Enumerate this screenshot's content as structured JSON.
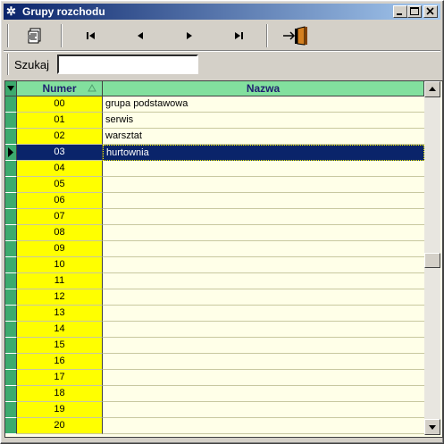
{
  "window": {
    "title": "Grupy rozchodu",
    "controls": [
      "minimize-icon",
      "maximize-icon",
      "close-icon"
    ]
  },
  "toolbar": {
    "buttons": [
      "report-icon",
      "first-record-icon",
      "prior-record-icon",
      "next-record-icon",
      "last-record-icon",
      "exit-icon"
    ]
  },
  "search": {
    "label": "Szukaj",
    "value": ""
  },
  "table": {
    "columns": [
      "Numer",
      "Nazwa"
    ],
    "selected_index": 3,
    "rows": [
      {
        "numer": "00",
        "nazwa": "grupa podstawowa"
      },
      {
        "numer": "01",
        "nazwa": "serwis"
      },
      {
        "numer": "02",
        "nazwa": "warsztat"
      },
      {
        "numer": "03",
        "nazwa": "hurtownia"
      },
      {
        "numer": "04",
        "nazwa": ""
      },
      {
        "numer": "05",
        "nazwa": ""
      },
      {
        "numer": "06",
        "nazwa": ""
      },
      {
        "numer": "07",
        "nazwa": ""
      },
      {
        "numer": "08",
        "nazwa": ""
      },
      {
        "numer": "09",
        "nazwa": ""
      },
      {
        "numer": "10",
        "nazwa": ""
      },
      {
        "numer": "11",
        "nazwa": ""
      },
      {
        "numer": "12",
        "nazwa": ""
      },
      {
        "numer": "13",
        "nazwa": ""
      },
      {
        "numer": "14",
        "nazwa": ""
      },
      {
        "numer": "15",
        "nazwa": ""
      },
      {
        "numer": "16",
        "nazwa": ""
      },
      {
        "numer": "17",
        "nazwa": ""
      },
      {
        "numer": "18",
        "nazwa": ""
      },
      {
        "numer": "19",
        "nazwa": ""
      },
      {
        "numer": "20",
        "nazwa": ""
      }
    ]
  },
  "colors": {
    "header_bg": "#82e09e",
    "indicator_bg": "#3caa6e",
    "numer_bg": "#ffff00",
    "grid_bg": "#ffffe8",
    "selection_bg": "#0a246a",
    "titlebar": "#0a246a"
  }
}
